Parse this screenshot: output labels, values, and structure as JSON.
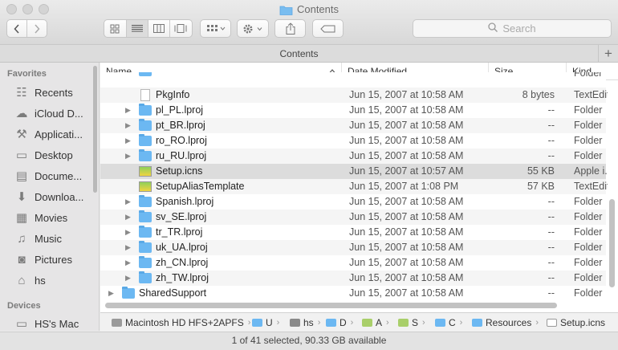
{
  "window": {
    "title": "Contents"
  },
  "toolbar": {
    "search_placeholder": "Search"
  },
  "tabbar": {
    "tab_label": "Contents",
    "plus": "+"
  },
  "sidebar": {
    "favorites_header": "Favorites",
    "locations_header": "Devices",
    "items": [
      {
        "label": "Recents",
        "icon": "recents-icon",
        "glyph": "☷"
      },
      {
        "label": "iCloud D...",
        "icon": "cloud-icon",
        "glyph": "☁"
      },
      {
        "label": "Applicati...",
        "icon": "applications-icon",
        "glyph": "⚒"
      },
      {
        "label": "Desktop",
        "icon": "desktop-icon",
        "glyph": "▭"
      },
      {
        "label": "Docume...",
        "icon": "documents-icon",
        "glyph": "▤"
      },
      {
        "label": "Downloa...",
        "icon": "downloads-icon",
        "glyph": "⬇"
      },
      {
        "label": "Movies",
        "icon": "movies-icon",
        "glyph": "▦"
      },
      {
        "label": "Music",
        "icon": "music-icon",
        "glyph": "♫"
      },
      {
        "label": "Pictures",
        "icon": "pictures-icon",
        "glyph": "◙"
      },
      {
        "label": "hs",
        "icon": "home-icon",
        "glyph": "⌂"
      }
    ],
    "devices": [
      {
        "label": "HS's Mac",
        "icon": "computer-icon",
        "glyph": "▭"
      }
    ]
  },
  "columns": {
    "name": "Name",
    "date": "Date Modified",
    "size": "Size",
    "kind": "Kind"
  },
  "rows": [
    {
      "name": "",
      "date": "",
      "size": "",
      "kind": "Folder",
      "type": "folder",
      "indent": 1,
      "expand": false,
      "clipped": true
    },
    {
      "name": "PkgInfo",
      "date": "Jun 15, 2007 at 10:58 AM",
      "size": "8 bytes",
      "kind": "TextEdit",
      "type": "doc",
      "indent": 1,
      "expand": false
    },
    {
      "name": "pl_PL.lproj",
      "date": "Jun 15, 2007 at 10:58 AM",
      "size": "--",
      "kind": "Folder",
      "type": "folder",
      "indent": 1,
      "expand": true
    },
    {
      "name": "pt_BR.lproj",
      "date": "Jun 15, 2007 at 10:58 AM",
      "size": "--",
      "kind": "Folder",
      "type": "folder",
      "indent": 1,
      "expand": true
    },
    {
      "name": "ro_RO.lproj",
      "date": "Jun 15, 2007 at 10:58 AM",
      "size": "--",
      "kind": "Folder",
      "type": "folder",
      "indent": 1,
      "expand": true
    },
    {
      "name": "ru_RU.lproj",
      "date": "Jun 15, 2007 at 10:58 AM",
      "size": "--",
      "kind": "Folder",
      "type": "folder",
      "indent": 1,
      "expand": true
    },
    {
      "name": "Setup.icns",
      "date": "Jun 15, 2007 at 10:57 AM",
      "size": "55 KB",
      "kind": "Apple i...",
      "type": "img",
      "indent": 1,
      "expand": false,
      "selected": true
    },
    {
      "name": "SetupAliasTemplate",
      "date": "Jun 15, 2007 at 1:08 PM",
      "size": "57 KB",
      "kind": "TextEdit",
      "type": "img",
      "indent": 1,
      "expand": false
    },
    {
      "name": "Spanish.lproj",
      "date": "Jun 15, 2007 at 10:58 AM",
      "size": "--",
      "kind": "Folder",
      "type": "folder",
      "indent": 1,
      "expand": true
    },
    {
      "name": "sv_SE.lproj",
      "date": "Jun 15, 2007 at 10:58 AM",
      "size": "--",
      "kind": "Folder",
      "type": "folder",
      "indent": 1,
      "expand": true
    },
    {
      "name": "tr_TR.lproj",
      "date": "Jun 15, 2007 at 10:58 AM",
      "size": "--",
      "kind": "Folder",
      "type": "folder",
      "indent": 1,
      "expand": true
    },
    {
      "name": "uk_UA.lproj",
      "date": "Jun 15, 2007 at 10:58 AM",
      "size": "--",
      "kind": "Folder",
      "type": "folder",
      "indent": 1,
      "expand": true
    },
    {
      "name": "zh_CN.lproj",
      "date": "Jun 15, 2007 at 10:58 AM",
      "size": "--",
      "kind": "Folder",
      "type": "folder",
      "indent": 1,
      "expand": true
    },
    {
      "name": "zh_TW.lproj",
      "date": "Jun 15, 2007 at 10:58 AM",
      "size": "--",
      "kind": "Folder",
      "type": "folder",
      "indent": 1,
      "expand": true
    },
    {
      "name": "SharedSupport",
      "date": "Jun 15, 2007 at 10:58 AM",
      "size": "--",
      "kind": "Folder",
      "type": "folder",
      "indent": 0,
      "expand": true
    }
  ],
  "pathbar": [
    {
      "label": "Macintosh HD HFS+2APFS",
      "icon": "disk-icon"
    },
    {
      "label": "U",
      "icon": "folder-icon"
    },
    {
      "label": "hs",
      "icon": "home-icon"
    },
    {
      "label": "D",
      "icon": "folder-icon"
    },
    {
      "label": "A",
      "icon": "app-icon"
    },
    {
      "label": "S",
      "icon": "app-icon"
    },
    {
      "label": "C",
      "icon": "folder-icon"
    },
    {
      "label": "Resources",
      "icon": "folder-icon"
    },
    {
      "label": "Setup.icns",
      "icon": "file-icon"
    }
  ],
  "status": {
    "text": "1 of 41 selected, 90.33 GB available"
  }
}
